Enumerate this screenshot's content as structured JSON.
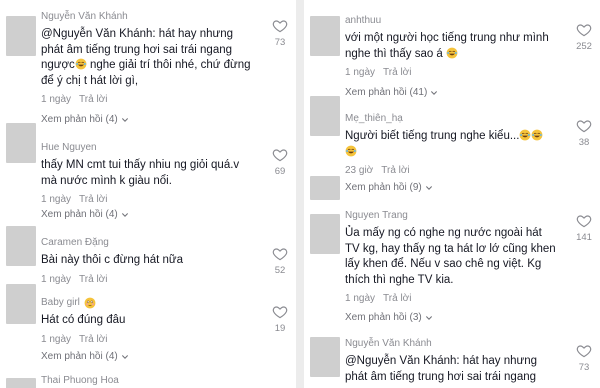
{
  "left": {
    "comments": [
      {
        "author": "Nguyễn Văn Khánh",
        "text": "@Nguyễn Văn Khánh: hát hay nhưng\nphát âm tiếng trung hơi sai trái ngang\nngược",
        "text_tail": " nghe giải trí thôi nhé, chứ đừng\nđể ý chị t hát lời gì,",
        "time": "1 ngày",
        "reply": "Trả lời",
        "likes": "73",
        "more": "Xem phản hồi (4)"
      },
      {
        "author": "Hue Nguyen",
        "text": "thấy MN cmt tui thấy nhiu ng giỏi quá.v\nmà nước mình k giàu nổi.",
        "time": "1 ngày",
        "reply": "Trả lời",
        "likes": "69",
        "more": "Xem phản hồi (4)"
      },
      {
        "author": "Caramen Đặng",
        "text": "Bài này thôi c đừng hát nữa",
        "time": "1 ngày",
        "reply": "Trả lời",
        "likes": "52",
        "more": ""
      },
      {
        "author": "Baby girl",
        "text": "Hát có đúng đâu",
        "time": "1 ngày",
        "reply": "Trả lời",
        "likes": "19",
        "more": "Xem phản hồi (4)"
      }
    ],
    "cut_author": "Thai Phuong Hoa"
  },
  "right": {
    "comments": [
      {
        "author": "anhthuu",
        "text": "với một người học tiếng trung như mình\nnghe thì thấy sao á",
        "time": "1 ngày",
        "reply": "Trả lời",
        "likes": "252",
        "more": "Xem phản hồi (41)"
      },
      {
        "author": "Mẹ_thiên_hạ",
        "text": "Người biết tiếng trung nghe kiểu...",
        "time": "23 giờ",
        "reply": "Trả lời",
        "likes": "38",
        "more": "Xem phản hồi (9)"
      },
      {
        "author": "Nguyen Trang",
        "text": "Ủa mấy ng có nghe ng nước ngoài hát\nTV kg, hay thấy ng ta hát lơ lớ cũng khen\nlấy khen để. Nếu v sao chê ng việt. Kg\nthích thì nghe TV kia.",
        "time": "1 ngày",
        "reply": "Trả lời",
        "likes": "141",
        "more": "Xem phản hồi (3)"
      },
      {
        "author": "Nguyễn Văn Khánh",
        "text": "@Nguyễn Văn Khánh: hát hay nhưng\nphát âm tiếng trung hơi sai trái ngang",
        "time": "",
        "reply": "",
        "likes": "73",
        "more": ""
      }
    ]
  },
  "colors": {
    "text": "#161823",
    "muted": "#8a8b91",
    "avatar_placeholder": "#cfcfcf",
    "background": "#ffffff"
  },
  "icons": {
    "like": "heart-outline-icon",
    "expand": "chevron-down-icon",
    "laugh": "laughing-emoji-icon",
    "flushed": "flushed-face-emoji-icon"
  }
}
